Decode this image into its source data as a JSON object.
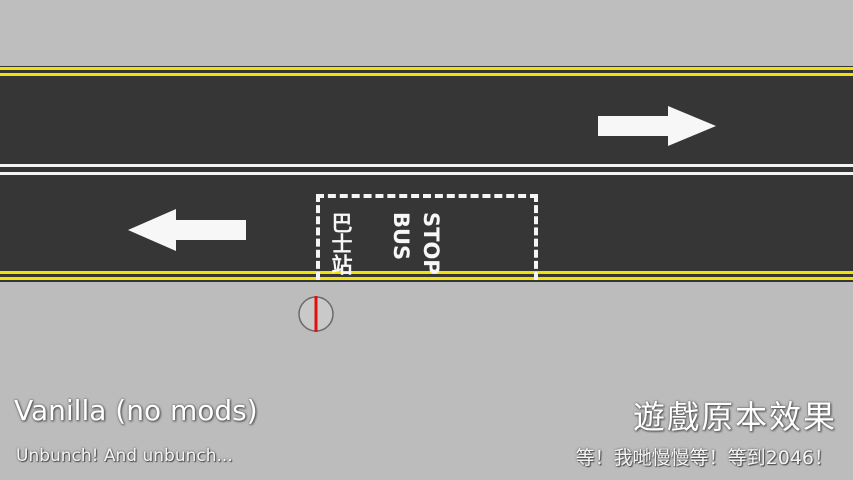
{
  "road_markings": {
    "bus_stop_chinese": "巴士站",
    "bus_stop_english_1": "BUS",
    "bus_stop_english_2": "STOP"
  },
  "icons": {
    "arrow_right": "arrow-right-icon",
    "arrow_left": "arrow-left-icon",
    "stop_marker": "bus-stop-marker-icon"
  },
  "colors": {
    "road": "#363636",
    "yellow_line": "#f2e20c",
    "white_line": "#f4f4f4",
    "pavement": "#bdbdbd",
    "marker_red": "#e01010"
  },
  "captions": {
    "left_title": "Vanilla (no mods)",
    "left_subtitle": "Unbunch! And unbunch...",
    "right_title": "遊戲原本效果",
    "right_subtitle": "等！我哋慢慢等！等到2046！"
  }
}
